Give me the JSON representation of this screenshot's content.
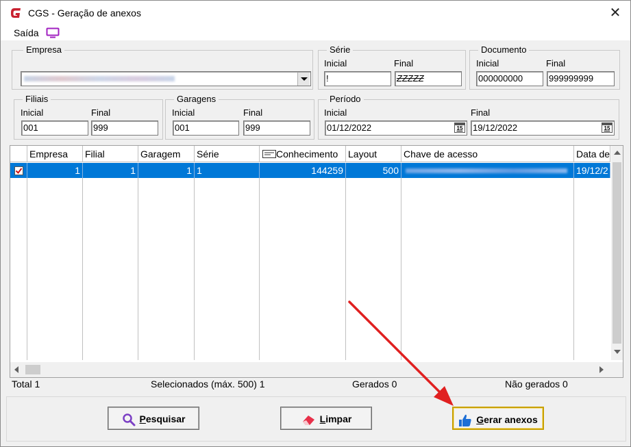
{
  "window": {
    "title": "CGS - Geração de anexos"
  },
  "menu": {
    "saida_label": "Saída",
    "icon": "monitor-icon"
  },
  "empresa": {
    "legend": "Empresa"
  },
  "serie": {
    "legend": "Série",
    "inicial_label": "Inicial",
    "final_label": "Final",
    "inicial_value": "!",
    "final_value": "ZZZZZ"
  },
  "documento": {
    "legend": "Documento",
    "inicial_label": "Inicial",
    "final_label": "Final",
    "inicial_value": "000000000",
    "final_value": "999999999"
  },
  "filiais": {
    "legend": "Filiais",
    "inicial_label": "Inicial",
    "final_label": "Final",
    "inicial_value": "001",
    "final_value": "999"
  },
  "garagens": {
    "legend": "Garagens",
    "inicial_label": "Inicial",
    "final_label": "Final",
    "inicial_value": "001",
    "final_value": "999"
  },
  "periodo": {
    "legend": "Período",
    "inicial_label": "Inicial",
    "final_label": "Final",
    "inicial_value": "01/12/2022",
    "final_value": "19/12/2022",
    "cal_label": "15"
  },
  "grid": {
    "columns": [
      "Empresa",
      "Filial",
      "Garagem",
      "Série",
      "Conhecimento",
      "Layout",
      "Chave de acesso",
      "Data de"
    ],
    "rows": [
      {
        "empresa": "1",
        "filial": "1",
        "garagem": "1",
        "serie": "1",
        "conhecimento": "144259",
        "layout": "500",
        "data": "19/12/2",
        "checked": true
      }
    ]
  },
  "status": {
    "total": "Total 1",
    "selecionados": "Selecionados (máx. 500) 1",
    "gerados": "Gerados 0",
    "nao_gerados": "Não gerados 0"
  },
  "buttons": {
    "pesquisar_u": "P",
    "pesquisar_rest": "esquisar",
    "limpar_u": "L",
    "limpar_rest": "impar",
    "gerar_u": "G",
    "gerar_rest": "erar anexos"
  },
  "colors": {
    "selection": "#0078d7",
    "brand": "#c8202f",
    "arrow": "#e02020",
    "accent_border": "#c8a000"
  }
}
